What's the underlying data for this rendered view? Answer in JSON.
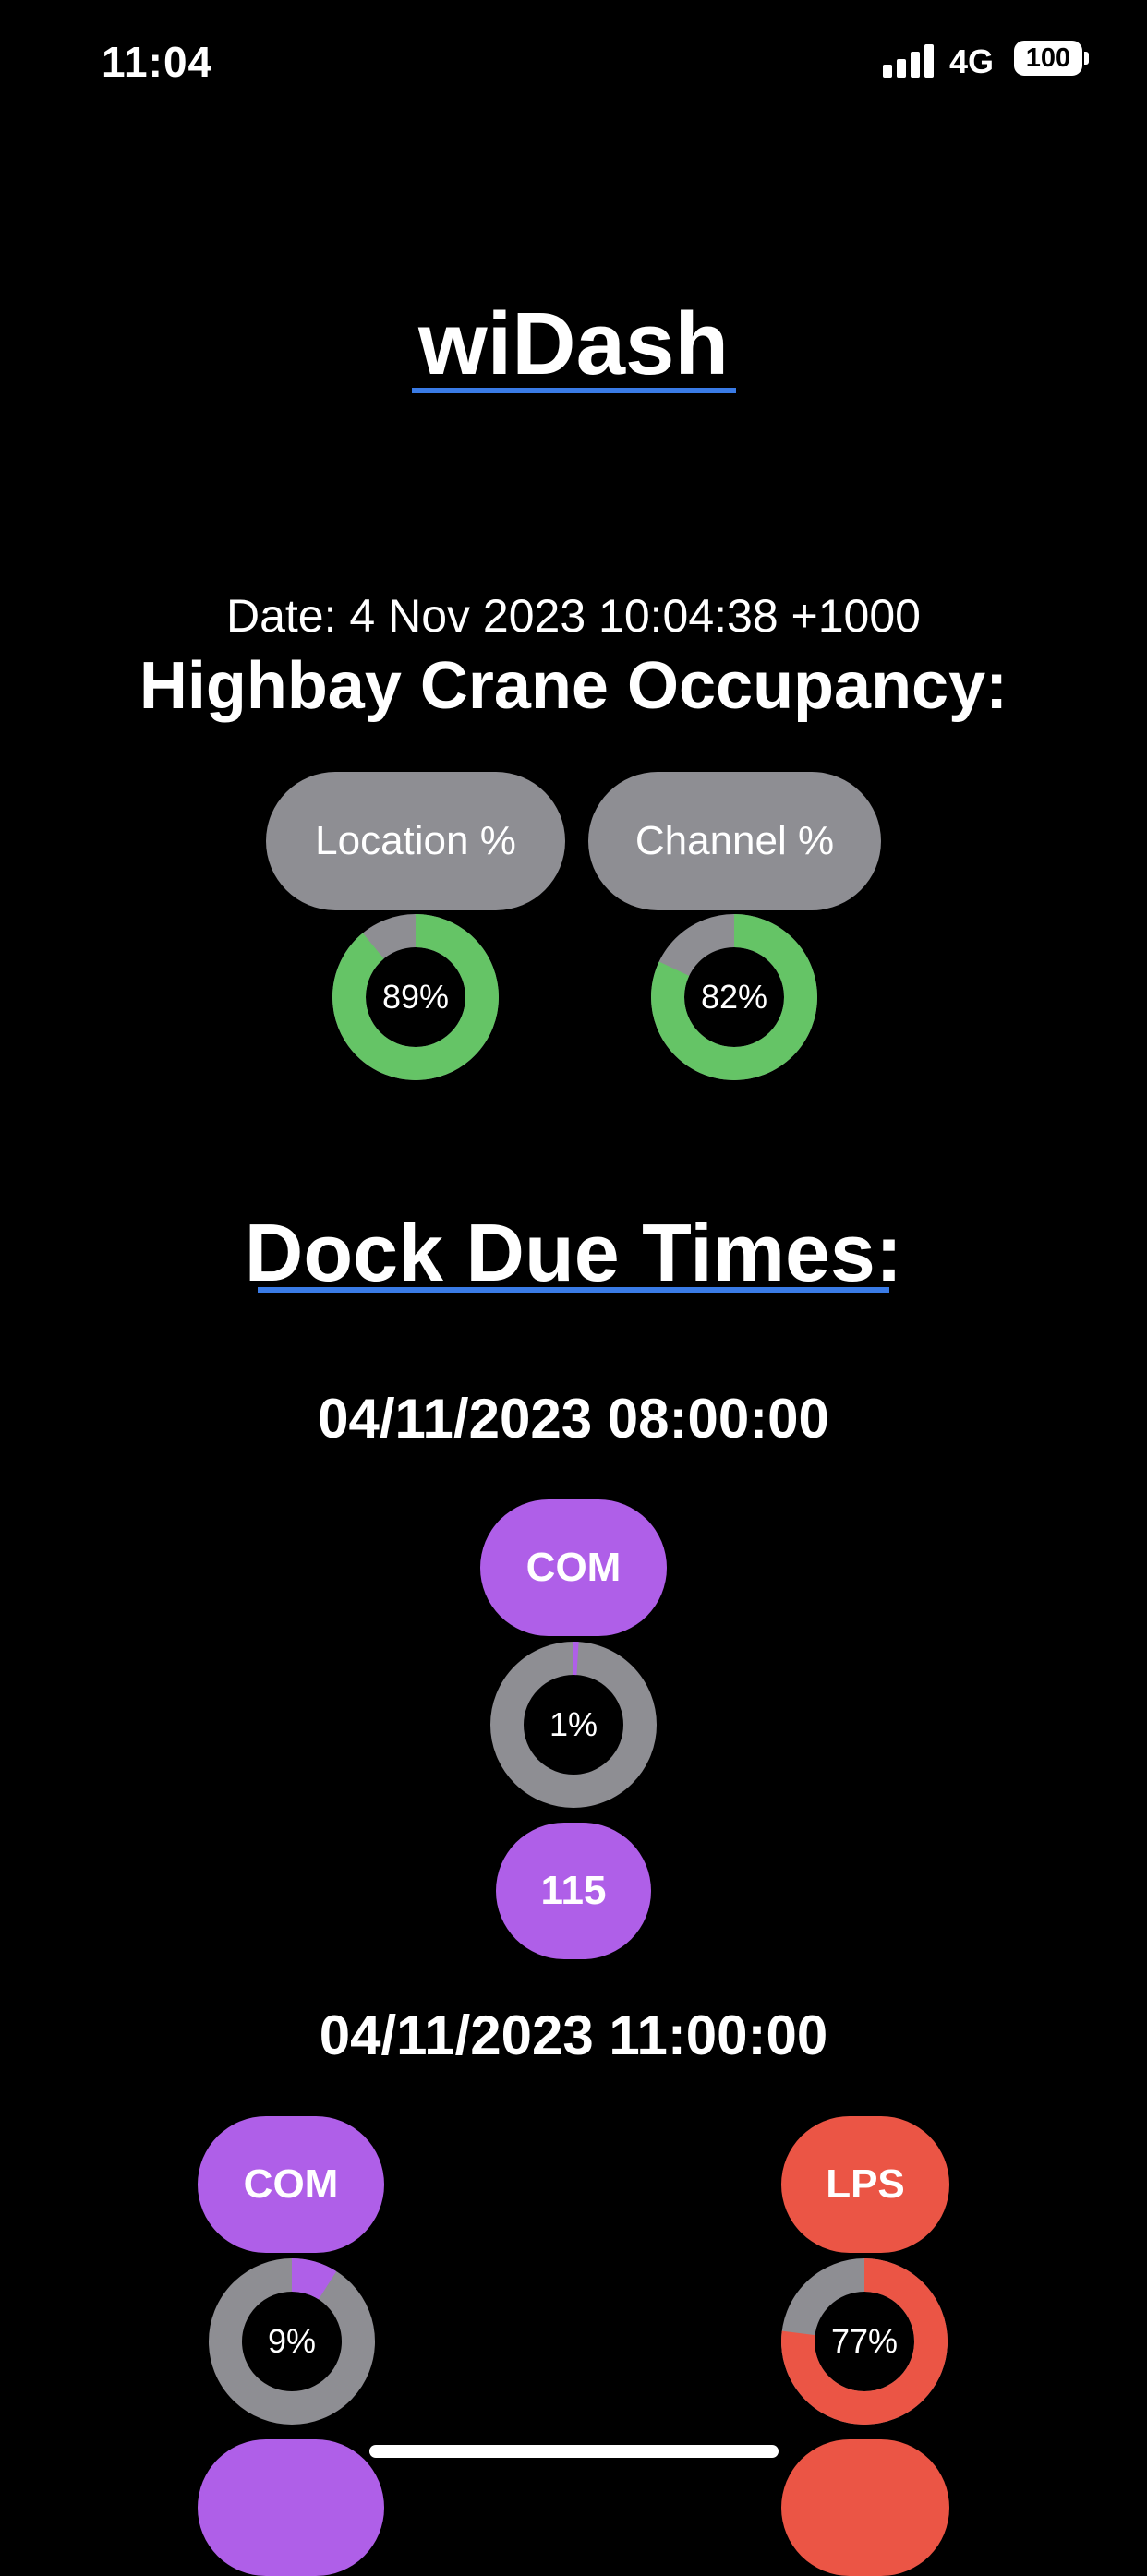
{
  "status_bar": {
    "time": "11:04",
    "network": "4G",
    "battery": "100"
  },
  "app": {
    "title": "wiDash"
  },
  "report": {
    "date": "Date: 4 Nov 2023 10:04:38 +1000",
    "crane_title": "Highbay Crane Occupancy:"
  },
  "crane": [
    {
      "label": "Location %",
      "value_label": "89%",
      "percent": 89,
      "color": "#65c466"
    },
    {
      "label": "Channel %",
      "value_label": "82%",
      "percent": 82,
      "color": "#65c466"
    }
  ],
  "dock": {
    "title": "Dock Due Times:",
    "groups": [
      {
        "time": "04/11/2023 08:00:00",
        "items": [
          {
            "code": "COM",
            "value_label": "1%",
            "percent": 1,
            "color": "#af5fe8",
            "count": "115"
          }
        ]
      },
      {
        "time": "04/11/2023 11:00:00",
        "items": [
          {
            "code": "COM",
            "value_label": "9%",
            "percent": 9,
            "color": "#af5fe8"
          },
          {
            "code": "LPS",
            "value_label": "77%",
            "percent": 77,
            "color": "#eb5545"
          }
        ]
      }
    ]
  },
  "colors": {
    "background": "#000000",
    "track": "#8e8e93",
    "accent_underline": "#3a7be6"
  }
}
